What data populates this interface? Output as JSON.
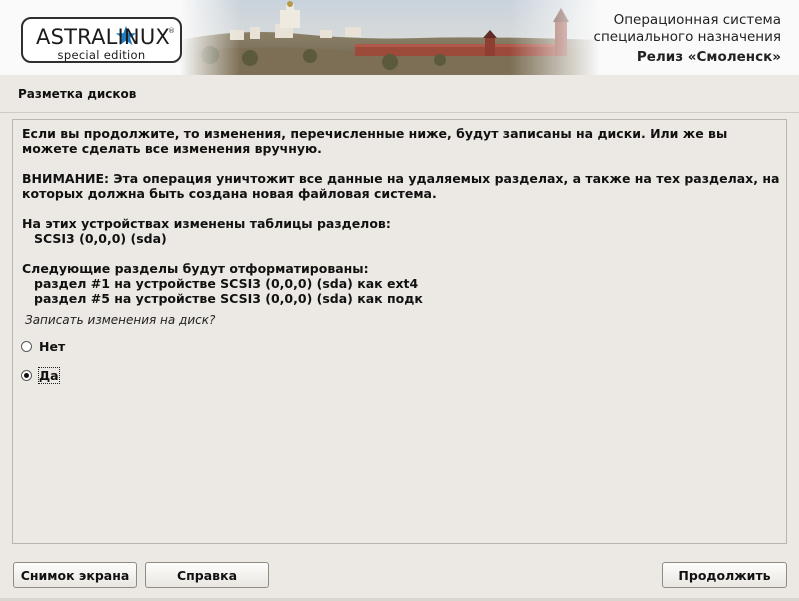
{
  "banner": {
    "logo_text": "ASTRALINUX",
    "logo_reg": "®",
    "logo_sub": "special edition",
    "line1": "Операционная система",
    "line2": "специального назначения",
    "line3": "Релиз «Смоленск»"
  },
  "title": "Разметка дисков",
  "content": {
    "para1": "Если вы продолжите, то изменения, перечисленные ниже, будут записаны на диски. Или же вы можете сделать все изменения вручную.",
    "para2": "ВНИМАНИЕ: Эта операция уничтожит все данные на удаляемых разделах, а также на тех разделах, на которых должна быть создана новая файловая система.",
    "tables_heading": "На этих устройствах изменены таблицы разделов:",
    "tables_device": "SCSI3 (0,0,0) (sda)",
    "format_heading": "Следующие разделы будут отформатированы:",
    "format_items": [
      "раздел #1 на устройстве SCSI3 (0,0,0) (sda) как ext4",
      "раздел #5 на устройстве SCSI3 (0,0,0) (sda) как подк"
    ],
    "question": "Записать изменения на диск?",
    "options": [
      {
        "label": "Нет",
        "checked": false
      },
      {
        "label": "Да",
        "checked": true
      }
    ]
  },
  "buttons": {
    "screenshot": "Снимок экрана",
    "help": "Справка",
    "continue": "Продолжить"
  }
}
